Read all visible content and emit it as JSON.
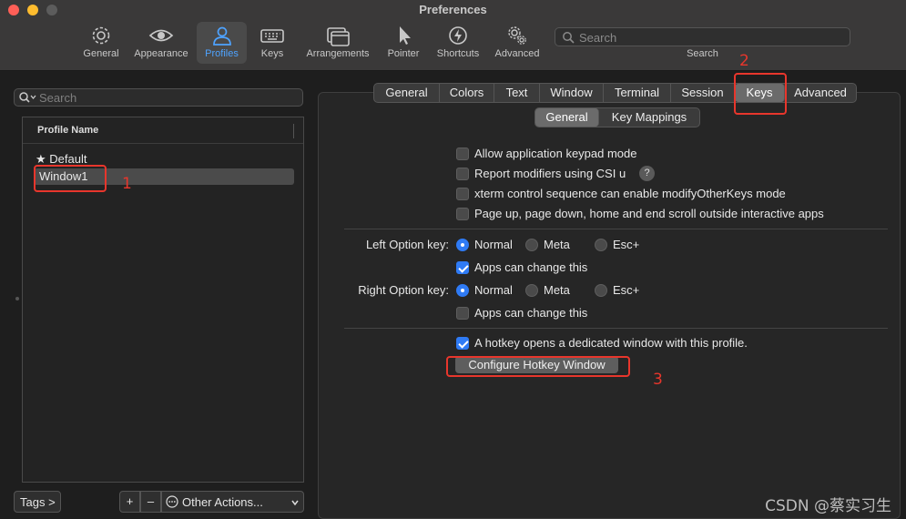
{
  "window": {
    "title": "Preferences"
  },
  "toolbar": {
    "items": [
      {
        "label": "General",
        "icon": "gear-icon"
      },
      {
        "label": "Appearance",
        "icon": "eye-icon"
      },
      {
        "label": "Profiles",
        "icon": "person-icon",
        "selected": true
      },
      {
        "label": "Keys",
        "icon": "keyboard-icon"
      },
      {
        "label": "Arrangements",
        "icon": "windows-icon"
      },
      {
        "label": "Pointer",
        "icon": "cursor-icon"
      },
      {
        "label": "Shortcuts",
        "icon": "bolt-icon"
      },
      {
        "label": "Advanced",
        "icon": "gears-icon"
      }
    ],
    "search_placeholder": "Search",
    "search_caption": "Search"
  },
  "left": {
    "search_placeholder": "Search",
    "column_header": "Profile Name",
    "profiles": [
      {
        "name": "Default",
        "default_star": "★"
      },
      {
        "name": "Window1",
        "selected": true
      }
    ],
    "tags_button": "Tags >",
    "add_button": "+",
    "remove_button": "–",
    "other_actions": "Other Actions..."
  },
  "tabs": {
    "items": [
      "General",
      "Colors",
      "Text",
      "Window",
      "Terminal",
      "Session",
      "Keys",
      "Advanced"
    ],
    "selected": "Keys"
  },
  "subtabs": {
    "items": [
      "General",
      "Key Mappings"
    ],
    "selected": "General"
  },
  "options": {
    "keypad_mode": "Allow application keypad mode",
    "csi_u": "Report modifiers using CSI u",
    "help_glyph": "?",
    "modify_other_keys": "xterm control sequence can enable modifyOtherKeys mode",
    "page_scroll": "Page up, page down, home and end scroll outside interactive apps",
    "left_option_label": "Left Option key:",
    "right_option_label": "Right Option key:",
    "normal": "Normal",
    "meta": "Meta",
    "esc": "Esc+",
    "apps_change": "Apps can change this",
    "hotkey_opens": "A hotkey opens a dedicated window with this profile.",
    "configure_hotkey": "Configure Hotkey Window"
  },
  "annotations": {
    "one": "1",
    "two": "2",
    "three": "3"
  },
  "watermark": "CSDN @蔡实习生",
  "colors": {
    "accent": "#2f7bf5",
    "annotation": "#e8362c",
    "selected_tool": "#4ea3ff"
  }
}
